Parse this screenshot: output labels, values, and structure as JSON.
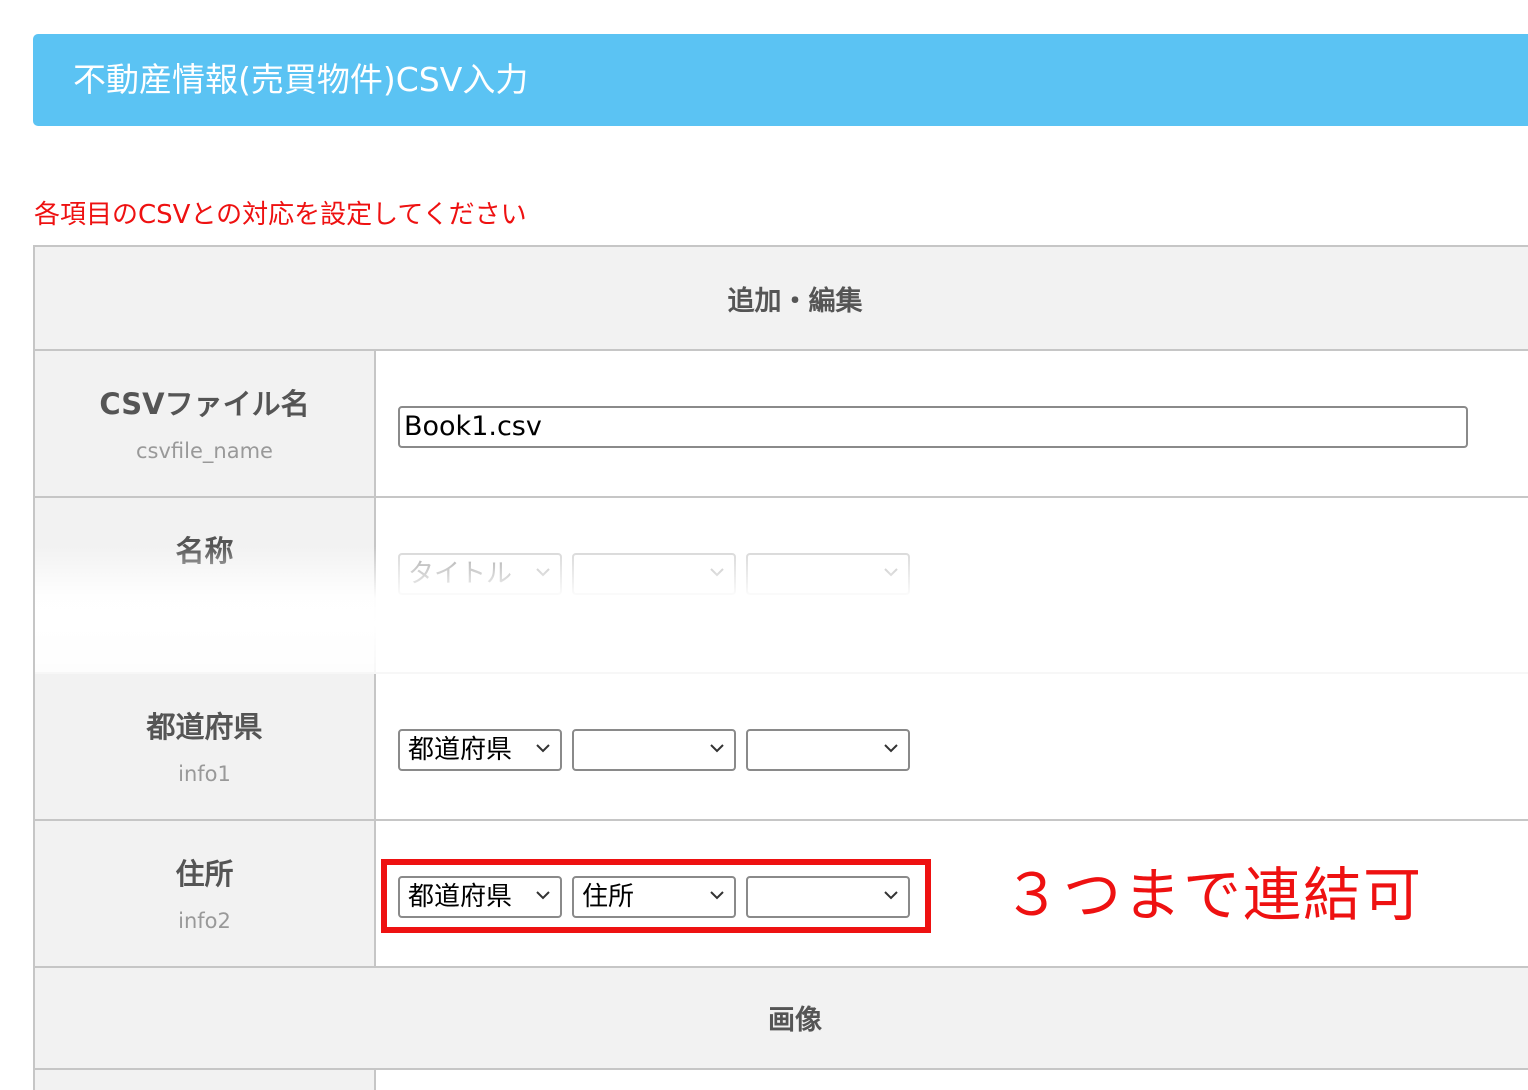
{
  "header": {
    "title": "不動産情報(売買物件)CSV入力"
  },
  "instruction": "各項目のCSVとの対応を設定してください",
  "sections": {
    "edit": "追加・編集",
    "image": "画像"
  },
  "rows": {
    "csvfile": {
      "label": "CSVファイル名",
      "key": "csvfile_name",
      "value": "Book1.csv"
    },
    "name": {
      "label": "名称",
      "selects": [
        "タイトル",
        "",
        ""
      ]
    },
    "info1": {
      "label": "都道府県",
      "key": "info1",
      "selects": [
        "都道府県",
        "",
        ""
      ]
    },
    "info2": {
      "label": "住所",
      "key": "info2",
      "selects": [
        "都道府県",
        "住所",
        ""
      ]
    }
  },
  "annotation": "３つまで連結可",
  "colors": {
    "header_bg": "#5bc3f3",
    "accent_red": "#ee1111",
    "label_bg": "#f2f2f2",
    "border": "#c6c6c6"
  }
}
